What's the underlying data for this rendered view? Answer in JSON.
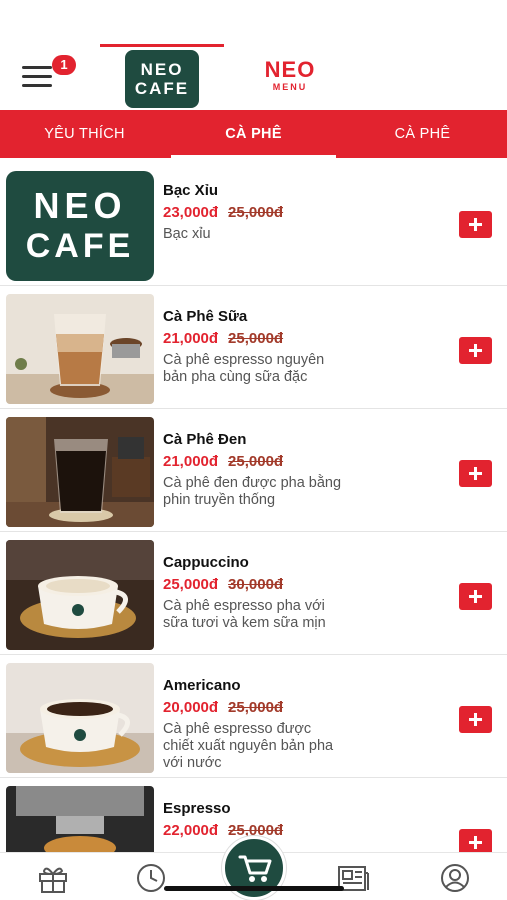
{
  "header": {
    "menu_badge": "1",
    "logo_neocafe_line1": "NEO",
    "logo_neocafe_line2": "CAFE",
    "logo_neomenu_line1": "NEO",
    "logo_neomenu_line2": "MENU"
  },
  "tabs": [
    {
      "label": "YÊU THÍCH",
      "active": false
    },
    {
      "label": "CÀ PHÊ",
      "active": true
    },
    {
      "label": "CÀ PHÊ",
      "active": false
    }
  ],
  "products": [
    {
      "name": "Bạc Xỉu",
      "price": "23,000đ",
      "old_price": "25,000đ",
      "desc": "Bạc xỉu",
      "image": "neo-cafe-logo"
    },
    {
      "name": "Cà Phê Sữa",
      "price": "21,000đ",
      "old_price": "25,000đ",
      "desc": "Cà phê espresso nguyên bản pha cùng sữa đặc",
      "image": "iced-milk-coffee"
    },
    {
      "name": "Cà Phê Đen",
      "price": "21,000đ",
      "old_price": "25,000đ",
      "desc": "Cà phê đen được pha bằng phin truyền thống",
      "image": "iced-black-coffee"
    },
    {
      "name": "Cappuccino",
      "price": "25,000đ",
      "old_price": "30,000đ",
      "desc": "Cà phê espresso pha với sữa tươi và kem sữa mịn",
      "image": "cappuccino-cup"
    },
    {
      "name": "Americano",
      "price": "20,000đ",
      "old_price": "25,000đ",
      "desc": "Cà phê espresso được chiết xuất nguyên bản pha với nước",
      "image": "americano-cup"
    },
    {
      "name": "Espresso",
      "price": "22,000đ",
      "old_price": "25,000đ",
      "desc": "",
      "image": "espresso-machine"
    }
  ],
  "bottom_nav": [
    "gift-icon",
    "clock-icon",
    "cart-icon",
    "news-icon",
    "user-icon"
  ],
  "colors": {
    "brand_red": "#e2232f",
    "brand_green": "#1f4b40"
  }
}
